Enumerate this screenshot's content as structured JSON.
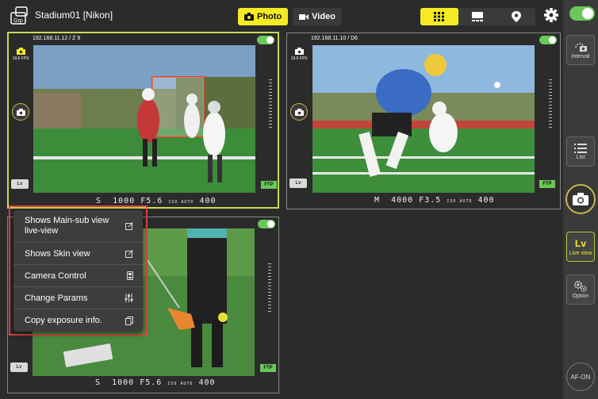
{
  "header": {
    "title": "Stadium01 [Nikon]",
    "photo_label": "Photo",
    "video_label": "Video",
    "grp_icon_text": "Grp"
  },
  "view_modes": [
    "grid-view-icon",
    "single-view-icon",
    "map-pin-icon"
  ],
  "rail": {
    "interval_label": "Interval",
    "list_label": "List",
    "lv_label": "Lv",
    "lv_sub_label": "Live view",
    "option_label": "Option",
    "af_label": "AF-ON"
  },
  "cameras": [
    {
      "address": "192.168.11.12 / Z 9",
      "fps": "19.6 FPS",
      "lv": "Lv",
      "ftp": "FTP",
      "mode": "S",
      "shutter": "1000",
      "aperture": "F5.6",
      "iso_label": "ISO AUTO",
      "iso": "400",
      "scene": "lacrosse-players-running",
      "selected": true
    },
    {
      "address": "192.168.11.10 / D6",
      "fps": "19.6 FPS",
      "lv": "Lv",
      "ftp": "FTP",
      "mode": "M",
      "shutter": "4000",
      "aperture": "F3.5",
      "iso_label": "ISO AUTO",
      "iso": "400",
      "scene": "lacrosse-player-scooping-ball",
      "selected": false
    },
    {
      "address": "",
      "fps": "",
      "lv": "Lv",
      "ftp": "FTP",
      "mode": "S",
      "shutter": "1000",
      "aperture": "F5.6",
      "iso_label": "ISO AUTO",
      "iso": "400",
      "scene": "lacrosse-stick-ball-closeup",
      "selected": false
    }
  ],
  "context_menu": {
    "items": [
      {
        "label": "Shows Main-sub view live-view",
        "icon": "external-link-icon"
      },
      {
        "label": "Shows Skin view",
        "icon": "external-link-icon"
      },
      {
        "label": "Camera Control",
        "icon": "device-icon"
      },
      {
        "label": "Change Params",
        "icon": "sliders-icon"
      },
      {
        "label": "Copy exposure info.",
        "icon": "copy-icon"
      }
    ]
  },
  "colors": {
    "accent_yellow": "#f5eb23",
    "toggle_green": "#6bc85a",
    "selection_border": "#c9d95a",
    "highlight_red": "#e0443e"
  }
}
